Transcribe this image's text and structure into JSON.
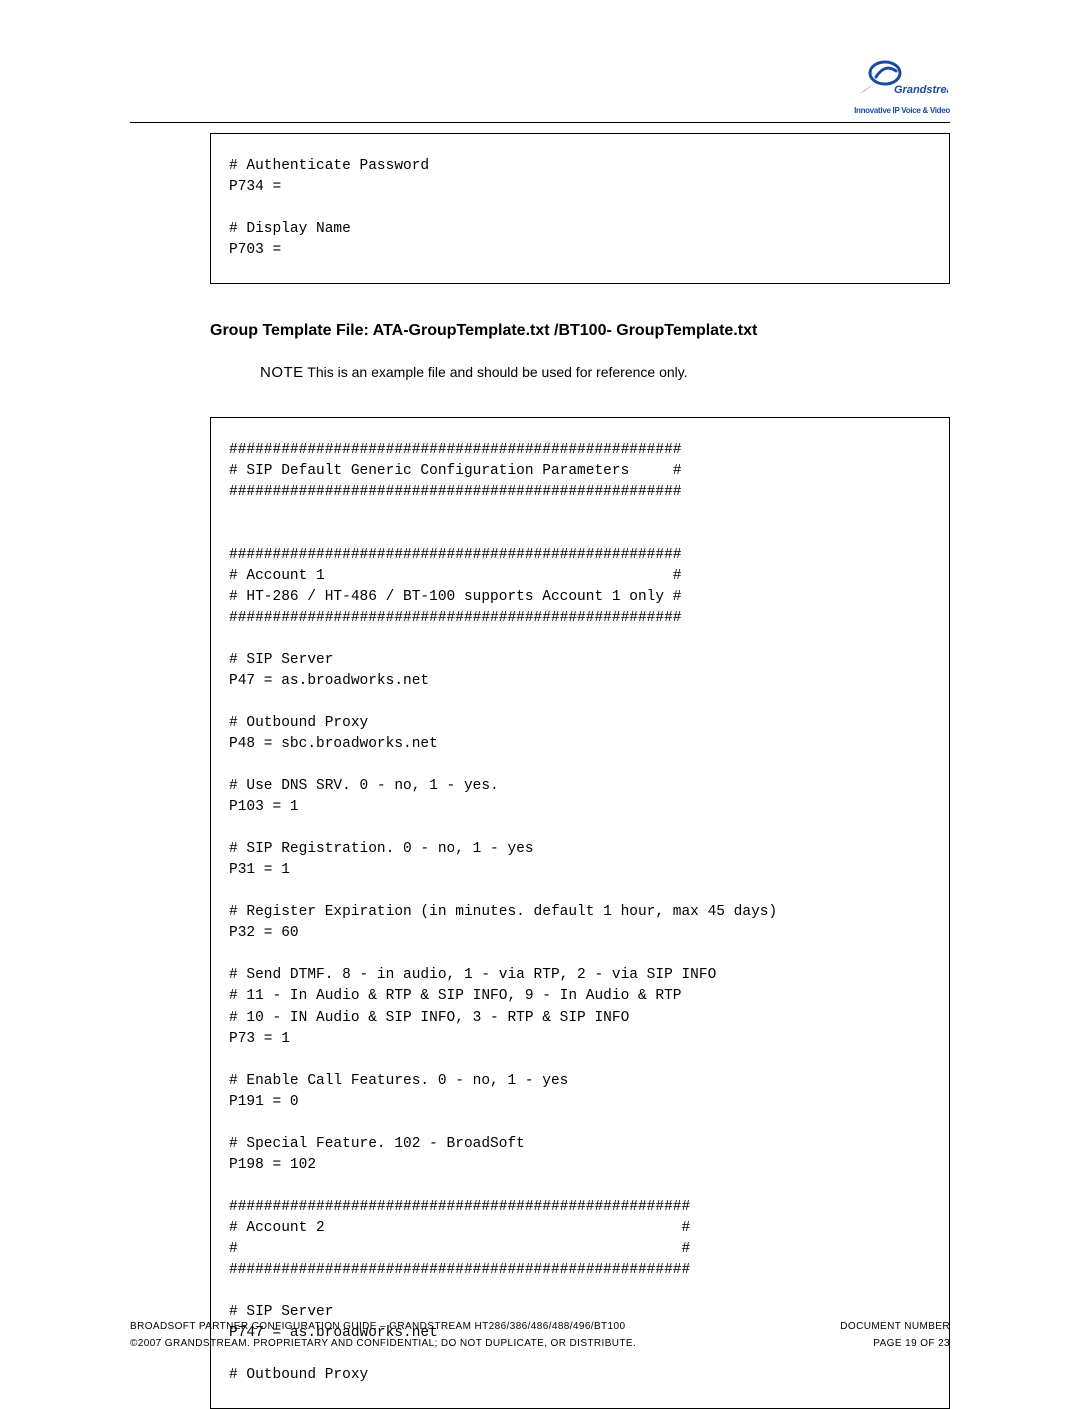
{
  "logo": {
    "brand_text": "Grandstream",
    "tagline": "Innovative IP Voice & Video"
  },
  "code_block_1": "# Authenticate Password\nP734 =\n\n# Display Name\nP703 =",
  "section_heading": "Group Template File:  ATA-GroupTemplate.txt /BT100- GroupTemplate.txt",
  "note": {
    "label": "NOTE",
    "text": " This is an example file and should be used for reference only."
  },
  "code_block_2": "####################################################\n# SIP Default Generic Configuration Parameters     #\n####################################################\n\n\n####################################################\n# Account 1                                        #\n# HT-286 / HT-486 / BT-100 supports Account 1 only #\n####################################################\n\n# SIP Server\nP47 = as.broadworks.net\n\n# Outbound Proxy\nP48 = sbc.broadworks.net\n\n# Use DNS SRV. 0 - no, 1 - yes.\nP103 = 1\n\n# SIP Registration. 0 - no, 1 - yes\nP31 = 1\n\n# Register Expiration (in minutes. default 1 hour, max 45 days)\nP32 = 60\n\n# Send DTMF. 8 - in audio, 1 - via RTP, 2 - via SIP INFO\n# 11 - In Audio & RTP & SIP INFO, 9 - In Audio & RTP\n# 10 - IN Audio & SIP INFO, 3 - RTP & SIP INFO\nP73 = 1\n\n# Enable Call Features. 0 - no, 1 - yes\nP191 = 0\n\n# Special Feature. 102 - BroadSoft\nP198 = 102\n\n#####################################################\n# Account 2                                         #\n#                                                   #\n#####################################################\n\n# SIP Server\nP747 = as.broadworks.net\n\n# Outbound Proxy",
  "footer": {
    "left1": "BROADSOFT PARTNER CONFIGURATION GUIDE – GRANDSTREAM HT286/386/486/488/496/BT100",
    "right1": "DOCUMENT NUMBER",
    "left2": "©2007 GRANDSTREAM.  PROPRIETARY AND CONFIDENTIAL; DO NOT DUPLICATE, OR DISTRIBUTE.",
    "right2": "PAGE 19 OF 23"
  }
}
